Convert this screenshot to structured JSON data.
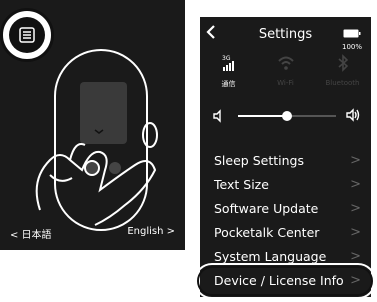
{
  "left_panel": {
    "nav_prev": "< 日本語",
    "nav_next": "English >"
  },
  "settings": {
    "title": "Settings",
    "battery": "100%",
    "status": [
      {
        "label_top": "3G",
        "label": "通信",
        "icon": "signal-icon",
        "active": true
      },
      {
        "label": "Wi-Fi",
        "icon": "wifi-icon",
        "active": false
      },
      {
        "label": "Bluetooth",
        "icon": "bluetooth-icon",
        "active": false
      }
    ],
    "volume_level": 0.5,
    "menu": [
      "Sleep Settings",
      "Text Size",
      "Software Update",
      "Pocketalk Center",
      "System Language",
      "Device / License Info"
    ],
    "chevron": ">"
  },
  "colors": {
    "panel_bg": "#1a1a1a",
    "text": "#ffffff",
    "muted": "#555555"
  }
}
